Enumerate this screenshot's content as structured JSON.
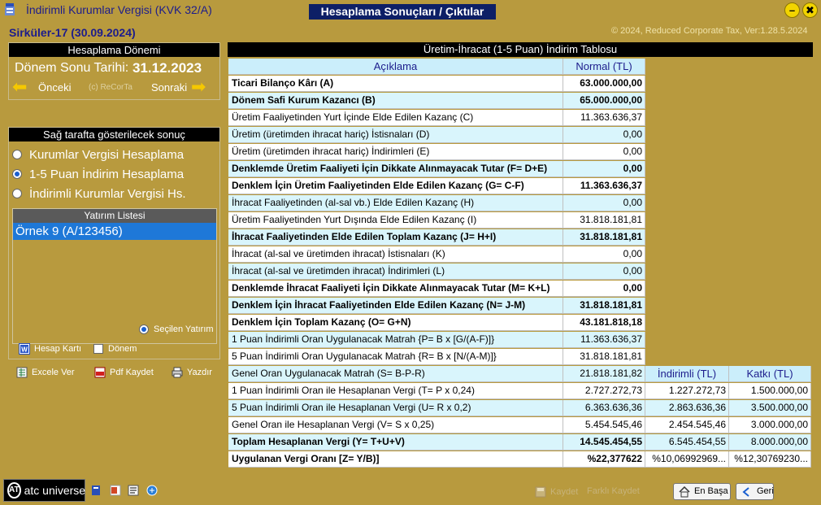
{
  "titlebar": {
    "app_title": "İndirimli Kurumlar Vergisi (KVK 32/A)",
    "center_title": "Hesaplama Sonuçları / Çıktılar",
    "minimize_glyph": "–",
    "close_glyph": "✖"
  },
  "circular": "Sirküler-17 (30.09.2024)",
  "copyright": "© 2024, Reduced Corporate Tax, Ver:1.28.5.2024",
  "period": {
    "header": "Hesaplama Dönemi",
    "label": "Dönem Sonu Tarihi:",
    "value": "31.12.2023",
    "prev": "Önceki",
    "next": "Sonraki",
    "recorta": "(c) ReCorTa"
  },
  "result_panel": {
    "header": "Sağ tarafta gösterilecek sonuç",
    "options": [
      {
        "label": "Kurumlar Vergisi Hesaplama",
        "selected": false
      },
      {
        "label": "1-5 Puan İndirim Hesaplama",
        "selected": true
      },
      {
        "label": "İndirimli Kurumlar Vergisi Hs.",
        "selected": false
      }
    ],
    "investment_list": {
      "header": "Yatırım Listesi",
      "items": [
        "Örnek 9 (A/123456)"
      ]
    },
    "selected_investment": "Seçilen Yatırım",
    "account_card": "Hesap Kartı",
    "period_check": "Dönem"
  },
  "tools": {
    "excel": "Excele Ver",
    "pdf": "Pdf Kaydet",
    "print": "Yazdır"
  },
  "table": {
    "title": "Üretim-İhracat (1-5 Puan) İndirim Tablosu",
    "headers": {
      "description": "Açıklama",
      "normal": "Normal (TL)",
      "reduced": "İndirimli (TL)",
      "contribution": "Katkı (TL)"
    },
    "rows": [
      {
        "label": "Ticari Bilanço Kârı (A)",
        "normal": "63.000.000,00",
        "bold": true
      },
      {
        "label": "Dönem Safi Kurum Kazancı (B)",
        "normal": "65.000.000,00",
        "bold": true
      },
      {
        "label": "Üretim Faaliyetinden Yurt İçinde Elde Edilen Kazanç (C)",
        "normal": "11.363.636,37",
        "bold": false
      },
      {
        "label": "Üretim (üretimden ihracat hariç) İstisnaları (D)",
        "normal": "0,00",
        "bold": false
      },
      {
        "label": "Üretim (üretimden ihracat hariç) İndirimleri (E)",
        "normal": "0,00",
        "bold": false
      },
      {
        "label": "Denklemde Üretim Faaliyeti İçin Dikkate Alınmayacak Tutar (F= D+E)",
        "normal": "0,00",
        "bold": true
      },
      {
        "label": "Denklem İçin Üretim Faaliyetinden Elde Edilen Kazanç (G= C-F)",
        "normal": "11.363.636,37",
        "bold": true
      },
      {
        "label": "İhracat Faaliyetinden (al-sal vb.) Elde Edilen Kazanç (H)",
        "normal": "0,00",
        "bold": false
      },
      {
        "label": "Üretim Faaliyetinden Yurt Dışında Elde Edilen Kazanç (I)",
        "normal": "31.818.181,81",
        "bold": false
      },
      {
        "label": "İhracat Faaliyetinden Elde Edilen Toplam Kazanç (J= H+I)",
        "normal": "31.818.181,81",
        "bold": true
      },
      {
        "label": "İhracat (al-sal ve üretimden ihracat) İstisnaları (K)",
        "normal": "0,00",
        "bold": false
      },
      {
        "label": "İhracat (al-sal ve üretimden ihracat) İndirimleri (L)",
        "normal": "0,00",
        "bold": false
      },
      {
        "label": "Denklemde İhracat Faaliyeti İçin Dikkate Alınmayacak Tutar (M= K+L)",
        "normal": "0,00",
        "bold": true
      },
      {
        "label": "Denklem İçin İhracat Faaliyetinden Elde Edilen Kazanç (N= J-M)",
        "normal": "31.818.181,81",
        "bold": true
      },
      {
        "label": "Denklem İçin Toplam Kazanç (O= G+N)",
        "normal": "43.181.818,18",
        "bold": true
      },
      {
        "label": "1 Puan İndirimli Oran Uygulanacak Matrah {P= B x [G/(A-F)]}",
        "normal": "11.363.636,37",
        "bold": false
      },
      {
        "label": "5 Puan İndirimli Oran Uygulanacak Matrah {R= B x [N/(A-M)]}",
        "normal": "31.818.181,81",
        "bold": false
      },
      {
        "label": "Genel Oran Uygulanacak Matrah (S= B-P-R)",
        "normal": "21.818.181,82",
        "bold": false
      },
      {
        "label": "1 Puan İndirimli Oran ile Hesaplanan Vergi (T= P x 0,24)",
        "normal": "2.727.272,73",
        "reduced": "1.227.272,73",
        "contribution": "1.500.000,00",
        "bold": false
      },
      {
        "label": "5 Puan İndirimli Oran ile Hesaplanan Vergi (U= R x 0,2)",
        "normal": "6.363.636,36",
        "reduced": "2.863.636,36",
        "contribution": "3.500.000,00",
        "bold": false
      },
      {
        "label": "Genel Oran ile Hesaplanan Vergi (V= S x 0,25)",
        "normal": "5.454.545,46",
        "reduced": "2.454.545,46",
        "contribution": "3.000.000,00",
        "bold": false
      },
      {
        "label": "Toplam Hesaplanan Vergi (Y= T+U+V)",
        "normal": "14.545.454,55",
        "reduced": "6.545.454,55",
        "contribution": "8.000.000,00",
        "bold": true
      },
      {
        "label": "Uygulanan Vergi Oranı [Z= Y/B)]",
        "normal": "%22,377622",
        "reduced": "%10,06992969...",
        "contribution": "%12,30769230...",
        "bold": true
      }
    ]
  },
  "bottom": {
    "logo": "atc universe",
    "logo_mark": "AT",
    "save": "Kaydet",
    "save_copy": "Farklı Kaydet",
    "home": "En Başa",
    "back": "Geri"
  }
}
